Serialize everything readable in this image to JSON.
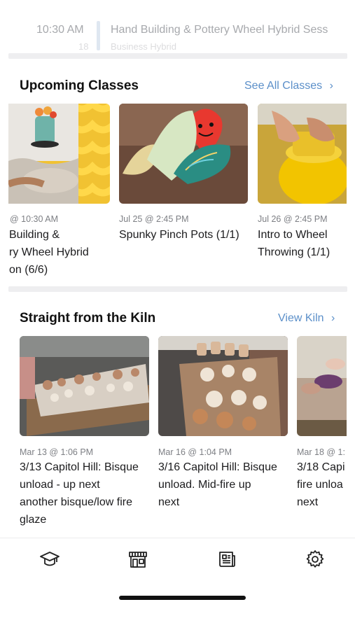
{
  "top_event": {
    "time": "10:30 AM",
    "title": "Hand Building & Pottery Wheel Hybrid Sess",
    "ghost_left": "18",
    "ghost_right": "Business Hybrid"
  },
  "upcoming": {
    "title": "Upcoming Classes",
    "link_label": "See All Classes",
    "cards": [
      {
        "date": "@ 10:30 AM",
        "title_lines": [
          "Building &",
          "ry Wheel Hybrid",
          "on (6/6)"
        ]
      },
      {
        "date": "Jul 25 @ 2:45 PM",
        "title_lines": [
          "Spunky Pinch Pots (1/1)"
        ]
      },
      {
        "date": "Jul 26 @ 2:45 PM",
        "title_lines": [
          "Intro to Wheel",
          "Throwing (1/1)"
        ]
      }
    ]
  },
  "kiln": {
    "title": "Straight from the Kiln",
    "link_label": "View Kiln",
    "cards": [
      {
        "date": "Mar 13 @ 1:06 PM",
        "title_lines": [
          "3/13 Capitol Hill: Bisque",
          "unload - up next",
          "another bisque/low fire",
          "glaze"
        ]
      },
      {
        "date": "Mar 16 @ 1:04 PM",
        "title_lines": [
          "3/16 Capitol Hill: Bisque",
          "unload. Mid-fire up",
          "next"
        ]
      },
      {
        "date": "Mar 18 @ 1:",
        "title_lines": [
          "3/18 Capi",
          "fire unloa",
          "next"
        ]
      }
    ]
  },
  "tabs": [
    {
      "icon": "graduation-cap-icon"
    },
    {
      "icon": "storefront-icon"
    },
    {
      "icon": "newspaper-icon"
    },
    {
      "icon": "gear-icon"
    }
  ],
  "colors": {
    "link": "#5b8fc9",
    "accent_yellow": "#f2c400"
  }
}
